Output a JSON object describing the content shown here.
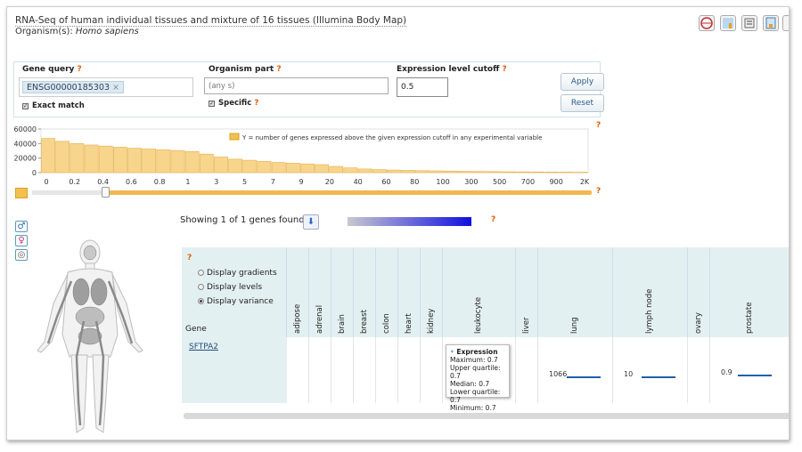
{
  "header": {
    "title": "RNA-Seq of human individual tissues and mixture of 16 tissues (Illumina Body Map)",
    "organism_label": "Organism(s):",
    "organism_value": "Homo sapiens"
  },
  "query": {
    "gene_label": "Gene query",
    "gene_tag": "ENSG00000185303",
    "gene_tag_remove": "×",
    "exact_match": "Exact match",
    "organism_part_label": "Organism part",
    "organism_part_placeholder": "(any s)",
    "specific": "Specific",
    "cutoff_label": "Expression level cutoff",
    "cutoff_value": "0.5",
    "apply": "Apply",
    "reset": "Reset",
    "help": "?"
  },
  "chart_data": {
    "type": "bar",
    "legend": "Y = number of genes expressed above the given expression cutoff in any experimental variable",
    "y_ticks": [
      "60000",
      "40000",
      "20000",
      "0"
    ],
    "ylim": [
      0,
      60000
    ],
    "x_ticks": [
      "0",
      "0.2",
      "0.4",
      "0.6",
      "0.8",
      "1",
      "3",
      "5",
      "7",
      "9",
      "20",
      "40",
      "60",
      "80",
      "100",
      "300",
      "500",
      "700",
      "900",
      "2K"
    ],
    "values": [
      47000,
      43000,
      40000,
      38000,
      36500,
      35000,
      33500,
      32500,
      31500,
      30500,
      29000,
      25500,
      21500,
      18500,
      17000,
      15500,
      14000,
      13000,
      12000,
      11000,
      8500,
      6500,
      5000,
      4200,
      3600,
      3100,
      2700,
      2400,
      2100,
      1800,
      1600,
      1400,
      1200,
      1050,
      900,
      780,
      680,
      580
    ]
  },
  "results": {
    "showing": "Showing 1 of 1 genes found:",
    "display_gradients": "Display gradients",
    "display_levels": "Display levels",
    "display_variance": "Display variance",
    "gene_col": "Gene",
    "gene_name": "SFTPA2",
    "columns": [
      "adipose",
      "adrenal",
      "brain",
      "breast",
      "colon",
      "heart",
      "kidney",
      "leukocyte",
      "liver",
      "lung",
      "lymph node",
      "ovary",
      "prostate"
    ],
    "lung_value": "1066",
    "lymph_value": "10",
    "prostate_value": "0.9",
    "tooltip": {
      "title": "Expression",
      "maximum": "Maximum: 0.7",
      "upper": "Upper quartile: 0.7",
      "median": "Median: 0.7",
      "lower": "Lower quartile: 0.7",
      "minimum": "Minimum: 0.7"
    }
  }
}
